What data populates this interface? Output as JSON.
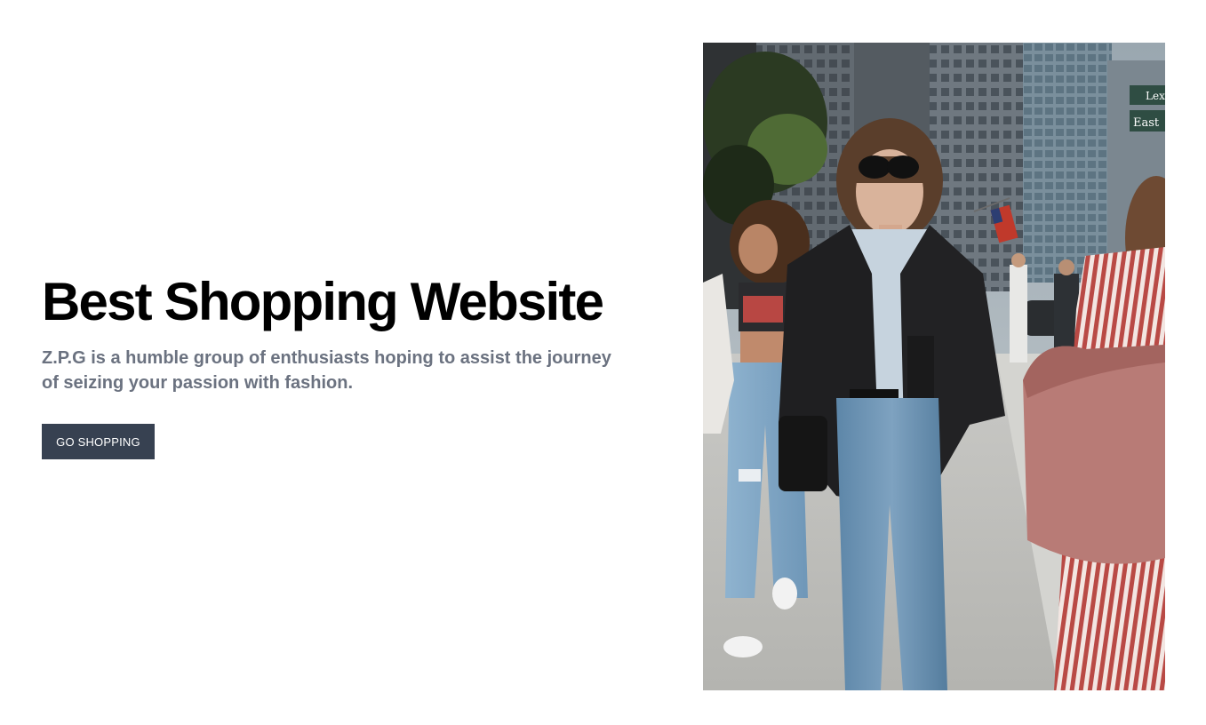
{
  "hero": {
    "title": "Best Shopping Website",
    "description": "Z.P.G is a humble group of enthusiasts hoping to assist the journey of seizing your passion with fashion.",
    "cta_label": "GO SHOPPING"
  },
  "image": {
    "sign_top": "Lex",
    "sign_bottom": "East"
  },
  "colors": {
    "title": "#000000",
    "description": "#6b7280",
    "button_bg": "#374151",
    "button_text": "#ffffff"
  }
}
